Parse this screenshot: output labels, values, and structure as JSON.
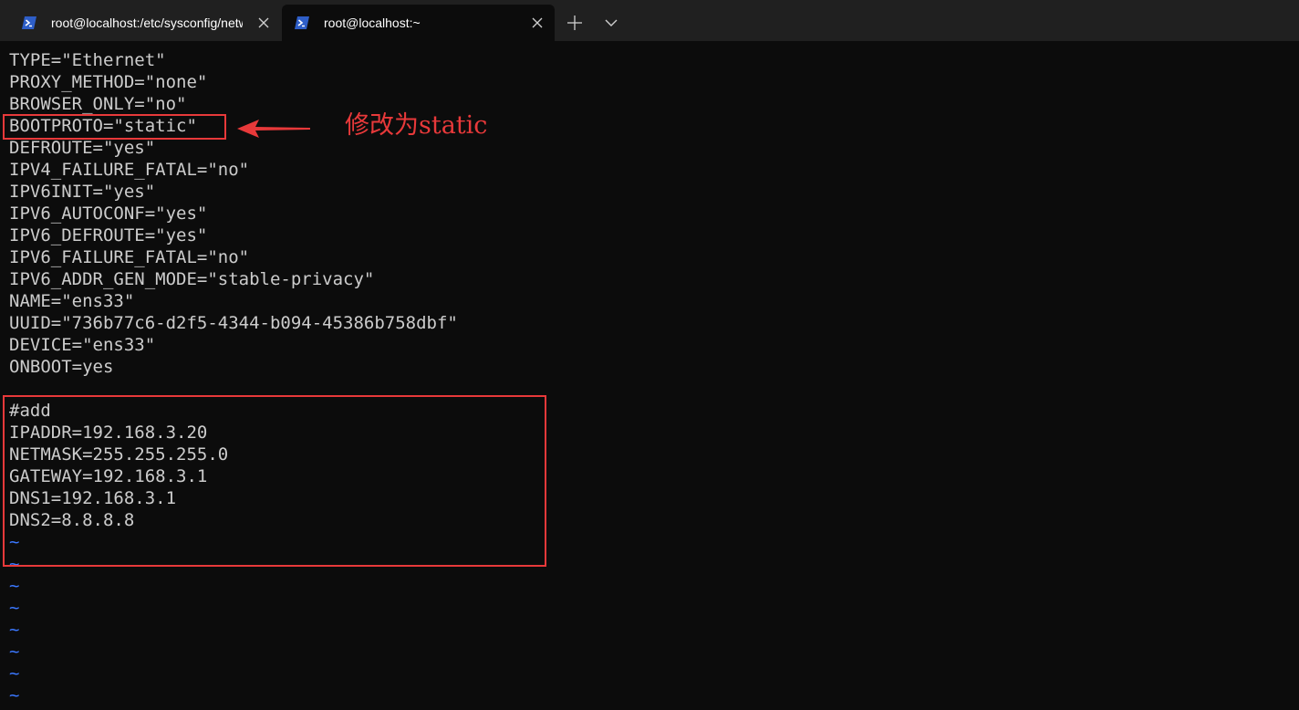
{
  "tabs": [
    {
      "title": "root@localhost:/etc/sysconfig/network-scripts",
      "active": false,
      "icon": "powershell-icon"
    },
    {
      "title": "root@localhost:~",
      "active": true,
      "icon": "powershell-icon"
    }
  ],
  "tabbar": {
    "new_tab_icon": "plus-icon",
    "dropdown_icon": "chevron-down-icon"
  },
  "terminal": {
    "lines": [
      "TYPE=\"Ethernet\"",
      "PROXY_METHOD=\"none\"",
      "BROWSER_ONLY=\"no\"",
      "BOOTPROTO=\"static\"",
      "DEFROUTE=\"yes\"",
      "IPV4_FAILURE_FATAL=\"no\"",
      "IPV6INIT=\"yes\"",
      "IPV6_AUTOCONF=\"yes\"",
      "IPV6_DEFROUTE=\"yes\"",
      "IPV6_FAILURE_FATAL=\"no\"",
      "IPV6_ADDR_GEN_MODE=\"stable-privacy\"",
      "NAME=\"ens33\"",
      "UUID=\"736b77c6-d2f5-4344-b094-45386b758dbf\"",
      "DEVICE=\"ens33\"",
      "ONBOOT=yes",
      "",
      "#add",
      "IPADDR=192.168.3.20",
      "NETMASK=255.255.255.0",
      "GATEWAY=192.168.3.1",
      "DNS1=192.168.3.1",
      "DNS2=8.8.8.8",
      "~",
      "~",
      "~",
      "~",
      "~",
      "~",
      "~",
      "~"
    ]
  },
  "annotation": {
    "text": "修改为static",
    "color": "#e8393a"
  },
  "colors": {
    "background": "#0c0c0c",
    "tabbar": "#202020",
    "foreground": "#cccccc",
    "tilde": "#3b78ff",
    "highlight": "#e8393a"
  }
}
